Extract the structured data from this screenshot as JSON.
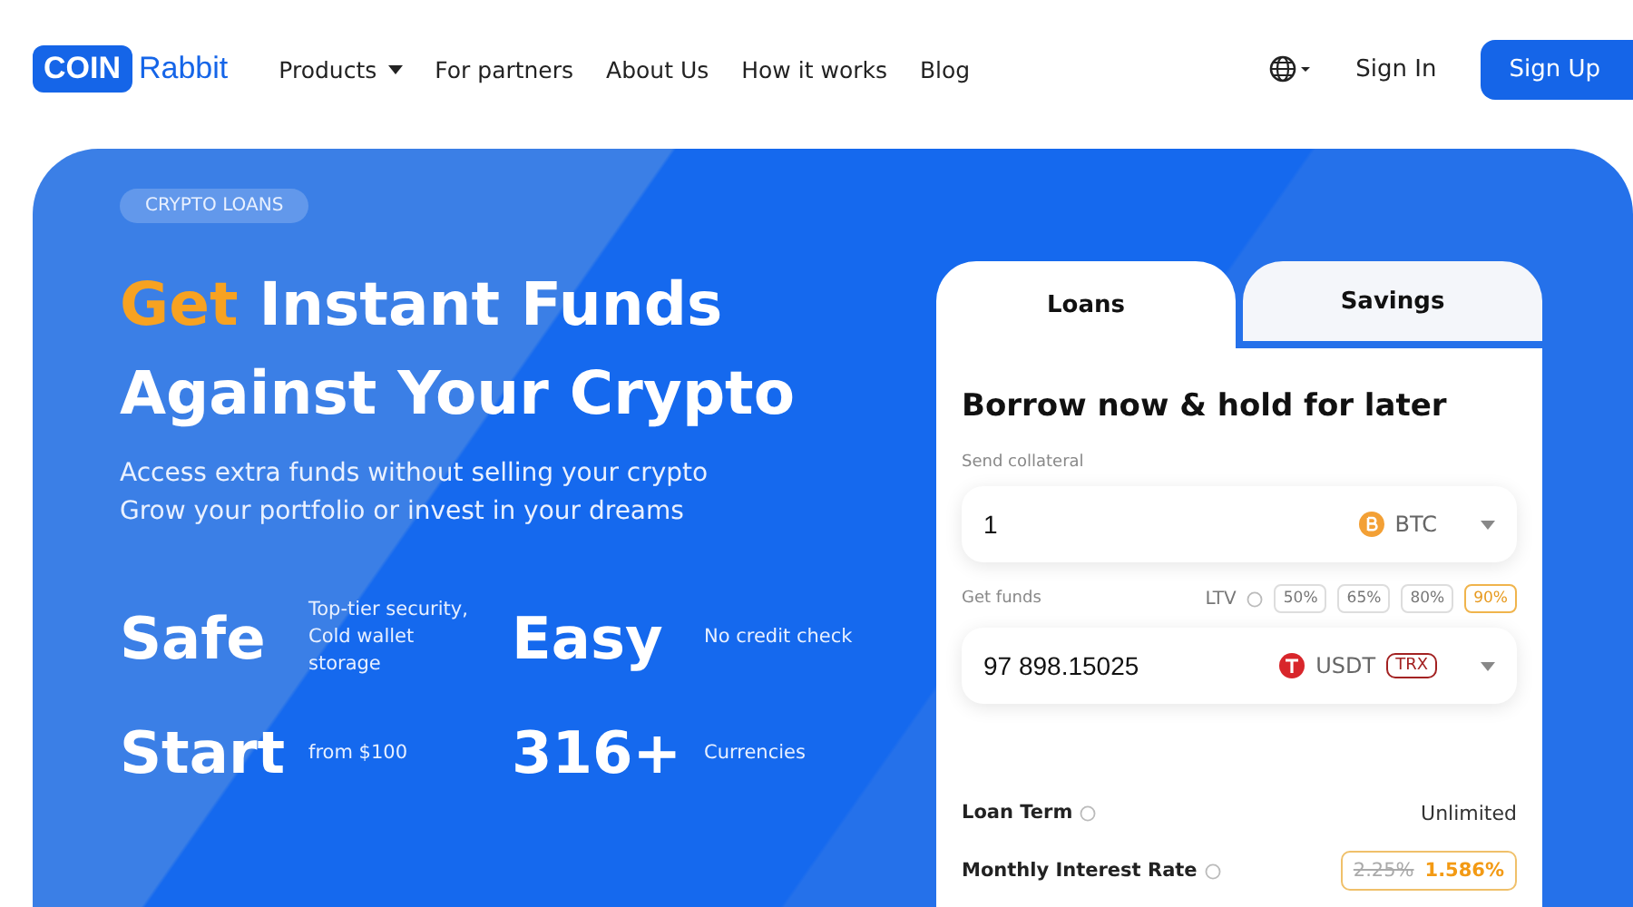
{
  "logo": {
    "badge": "COIN",
    "text": "Rabbit"
  },
  "nav": [
    {
      "label": "Products",
      "dropdown": true
    },
    {
      "label": "For partners",
      "dropdown": false
    },
    {
      "label": "About Us",
      "dropdown": false
    },
    {
      "label": "How it works",
      "dropdown": false
    },
    {
      "label": "Blog",
      "dropdown": false
    }
  ],
  "header_actions": {
    "sign_in": "Sign In",
    "sign_up": "Sign Up"
  },
  "hero": {
    "tag": "CRYPTO LOANS",
    "title_accent": "Get",
    "title_rest": "Instant Funds",
    "title_line2": "Against Your Crypto",
    "subtitle": [
      "Access extra funds without selling your crypto",
      "Grow your portfolio or invest in your dreams"
    ],
    "features": [
      {
        "title": "Safe",
        "text": "Top-tier security, Cold wallet storage"
      },
      {
        "title": "Easy",
        "text": "No credit check"
      },
      {
        "title": "Start",
        "text": "from $100"
      },
      {
        "title": "316+",
        "text": "Currencies"
      }
    ]
  },
  "card": {
    "tabs": [
      {
        "label": "Loans",
        "selected": true
      },
      {
        "label": "Savings",
        "selected": false
      }
    ],
    "heading": "Borrow now & hold for later",
    "collateral": {
      "label": "Send collateral",
      "value": "1",
      "currency": "BTC"
    },
    "funds": {
      "label": "Get funds",
      "value": "97 898.15025",
      "currency": "USDT",
      "network": "TRX"
    },
    "ltv": {
      "label": "LTV",
      "options": [
        {
          "label": "50%",
          "selected": false
        },
        {
          "label": "65%",
          "selected": false
        },
        {
          "label": "80%",
          "selected": false
        },
        {
          "label": "90%",
          "selected": true
        }
      ]
    },
    "details": [
      {
        "kind": "text",
        "label": "Loan Term",
        "value": "Unlimited"
      },
      {
        "kind": "rate",
        "label": "Monthly Interest Rate",
        "old": "2.25%",
        "value": "1.586%"
      }
    ]
  }
}
